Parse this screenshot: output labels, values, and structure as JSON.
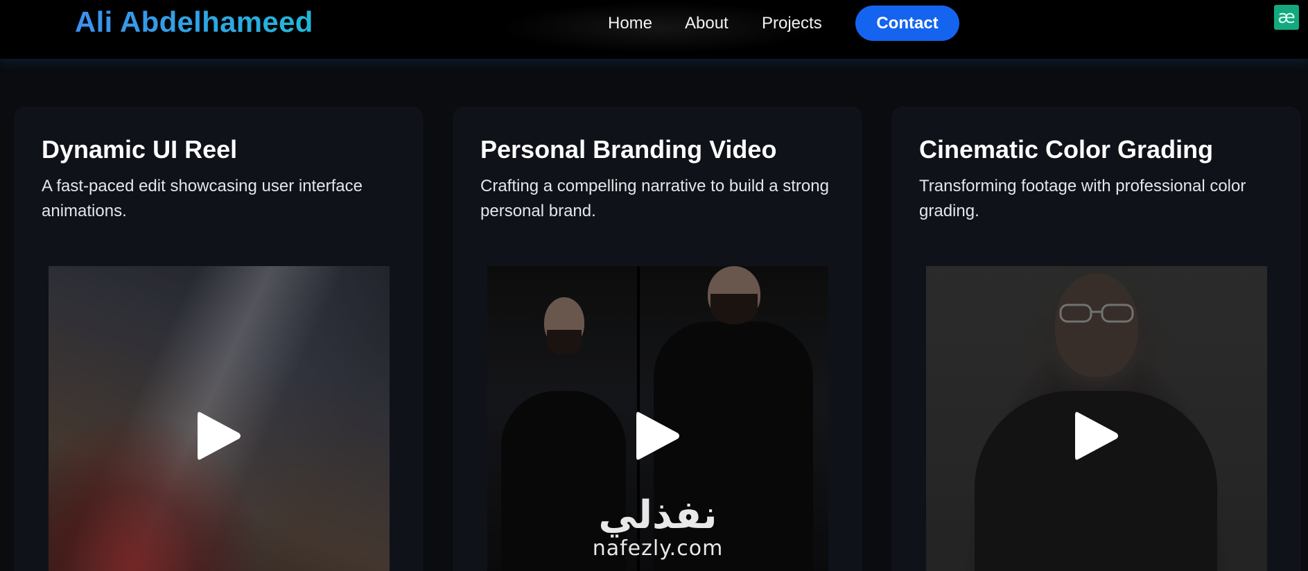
{
  "header": {
    "logo": "Ali Abdelhameed",
    "nav": [
      {
        "label": "Home"
      },
      {
        "label": "About"
      },
      {
        "label": "Projects"
      }
    ],
    "contact_label": "Contact",
    "extension_badge": "æ"
  },
  "projects": [
    {
      "title": "Dynamic UI Reel",
      "description": "A fast-paced edit showcasing user interface animations.",
      "thumbnail_icon": "play-icon"
    },
    {
      "title": "Personal Branding Video",
      "description": "Crafting a compelling narrative to build a strong personal brand.",
      "thumbnail_icon": "play-icon",
      "watermark_arabic": "نفذلي",
      "watermark_latin": "nafezly.com"
    },
    {
      "title": "Cinematic Color Grading",
      "description": "Transforming footage with professional color grading.",
      "thumbnail_icon": "play-icon"
    }
  ],
  "colors": {
    "background": "#0a0c10",
    "card": "#0f1219",
    "accent": "#1564f0",
    "logo_gradient_start": "#3d8ff0",
    "logo_gradient_end": "#22b8d8"
  }
}
